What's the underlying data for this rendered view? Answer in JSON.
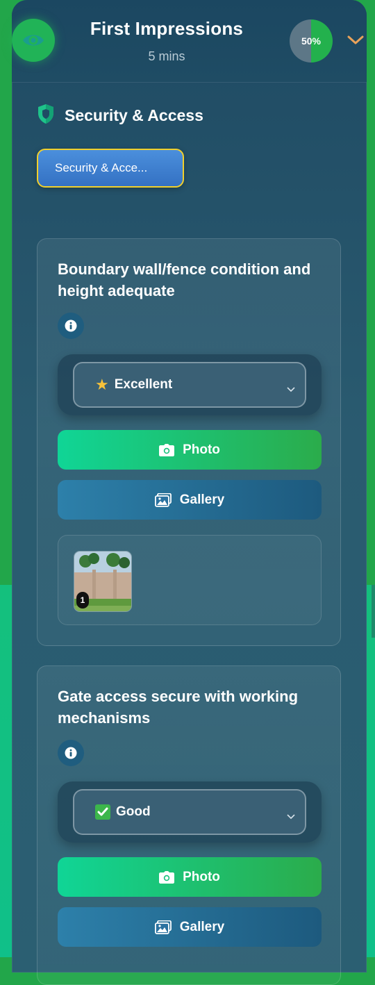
{
  "header": {
    "title": "First Impressions",
    "subtitle": "5 mins",
    "progress": 0.5,
    "progress_label": "50%",
    "icon": "eye-icon",
    "toggle_icon": "chevron-down-icon"
  },
  "section": {
    "icon": "shield-icon",
    "title": "Security & Access",
    "tag_label": "Security & Acce..."
  },
  "items": [
    {
      "question": "Boundary wall/fence condition and height adequate",
      "rating_emoji": "star",
      "rating": "Excellent",
      "photo_label": "Photo",
      "gallery_label": "Gallery",
      "photo_count": "1"
    },
    {
      "question": "Gate access secure with working mechanisms",
      "rating_emoji": "check",
      "rating": "Good",
      "photo_label": "Photo",
      "gallery_label": "Gallery"
    }
  ],
  "colors": {
    "accent_green": "#21b357",
    "tag_border": "#f1d02c",
    "tag_fill": "#3f7fd0",
    "chevron": "#e8a25a"
  }
}
